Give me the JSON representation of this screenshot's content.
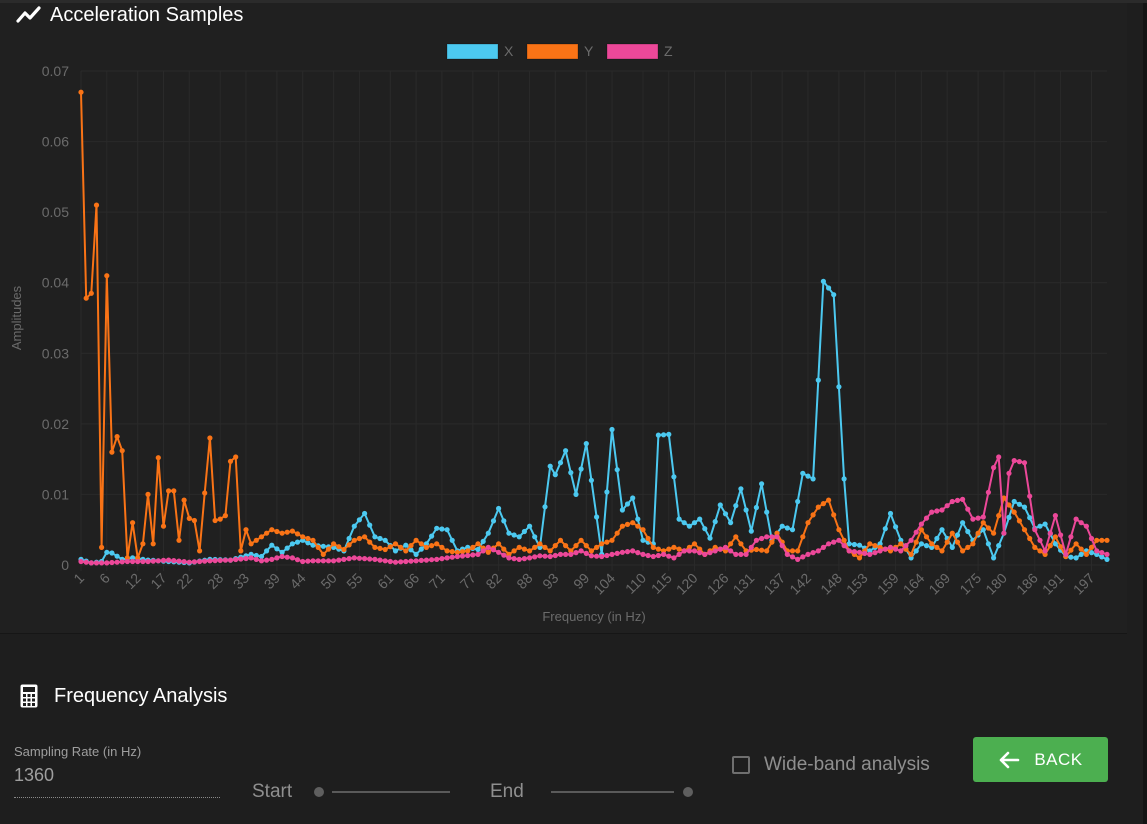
{
  "card": {
    "title": "Acceleration Samples",
    "icon": "line-chart-icon"
  },
  "chart_data": {
    "type": "line",
    "title": "Acceleration Samples",
    "xlabel": "Frequency (in Hz)",
    "ylabel": "Amplitudes",
    "ylim": [
      0,
      0.07
    ],
    "yticks": [
      "0",
      "0.01",
      "0.02",
      "0.03",
      "0.04",
      "0.05",
      "0.06",
      "0.07"
    ],
    "xlim": [
      1,
      200
    ],
    "xtick_labels": [
      "1",
      "6",
      "12",
      "17",
      "22",
      "28",
      "33",
      "39",
      "44",
      "50",
      "55",
      "61",
      "66",
      "71",
      "77",
      "82",
      "88",
      "93",
      "99",
      "104",
      "110",
      "115",
      "120",
      "126",
      "131",
      "137",
      "142",
      "148",
      "153",
      "159",
      "164",
      "169",
      "175",
      "180",
      "186",
      "191",
      "197"
    ],
    "grid": true,
    "legend": "top-center",
    "values_estimated": true,
    "values_note": "Key points are approximate readings traced from the rendered plot (about 200 dense samples per series). Intermediate samples are interpolated, not read.",
    "series": [
      {
        "name": "X",
        "color": "#4cc9f0",
        "key_points": [
          [
            1,
            0.0008
          ],
          [
            3,
            0.0003
          ],
          [
            5,
            0.0005
          ],
          [
            6,
            0.0018
          ],
          [
            7,
            0.0017
          ],
          [
            9,
            0.0008
          ],
          [
            11,
            0.001
          ],
          [
            14,
            0.0007
          ],
          [
            18,
            0.0005
          ],
          [
            22,
            0.0003
          ],
          [
            26,
            0.0008
          ],
          [
            30,
            0.0007
          ],
          [
            34,
            0.0015
          ],
          [
            36,
            0.0012
          ],
          [
            38,
            0.0028
          ],
          [
            40,
            0.0018
          ],
          [
            42,
            0.003
          ],
          [
            44,
            0.0035
          ],
          [
            46,
            0.0028
          ],
          [
            50,
            0.0025
          ],
          [
            52,
            0.002
          ],
          [
            54,
            0.0055
          ],
          [
            56,
            0.0073
          ],
          [
            58,
            0.004
          ],
          [
            60,
            0.0035
          ],
          [
            62,
            0.002
          ],
          [
            64,
            0.0028
          ],
          [
            66,
            0.0015
          ],
          [
            68,
            0.003
          ],
          [
            70,
            0.0052
          ],
          [
            72,
            0.005
          ],
          [
            74,
            0.002
          ],
          [
            76,
            0.0025
          ],
          [
            78,
            0.0022
          ],
          [
            80,
            0.0045
          ],
          [
            82,
            0.008
          ],
          [
            84,
            0.0045
          ],
          [
            86,
            0.004
          ],
          [
            88,
            0.0055
          ],
          [
            90,
            0.0025
          ],
          [
            92,
            0.014
          ],
          [
            93,
            0.0128
          ],
          [
            95,
            0.0162
          ],
          [
            97,
            0.01
          ],
          [
            99,
            0.0172
          ],
          [
            101,
            0.0068
          ],
          [
            102,
            0.0015
          ],
          [
            104,
            0.0192
          ],
          [
            106,
            0.0078
          ],
          [
            108,
            0.0095
          ],
          [
            110,
            0.0035
          ],
          [
            112,
            0.003
          ],
          [
            113,
            0.0184
          ],
          [
            115,
            0.0185
          ],
          [
            117,
            0.0065
          ],
          [
            119,
            0.0055
          ],
          [
            121,
            0.0065
          ],
          [
            123,
            0.0038
          ],
          [
            125,
            0.0085
          ],
          [
            127,
            0.006
          ],
          [
            129,
            0.0108
          ],
          [
            131,
            0.0048
          ],
          [
            133,
            0.0115
          ],
          [
            135,
            0.0035
          ],
          [
            137,
            0.0055
          ],
          [
            139,
            0.005
          ],
          [
            141,
            0.013
          ],
          [
            143,
            0.0122
          ],
          [
            145,
            0.0402
          ],
          [
            147,
            0.0383
          ],
          [
            149,
            0.0122
          ],
          [
            150,
            0.003
          ],
          [
            152,
            0.0028
          ],
          [
            154,
            0.002
          ],
          [
            156,
            0.003
          ],
          [
            158,
            0.0073
          ],
          [
            160,
            0.0035
          ],
          [
            162,
            0.001
          ],
          [
            164,
            0.003
          ],
          [
            166,
            0.0025
          ],
          [
            168,
            0.005
          ],
          [
            170,
            0.0025
          ],
          [
            172,
            0.006
          ],
          [
            174,
            0.0035
          ],
          [
            176,
            0.005
          ],
          [
            178,
            0.001
          ],
          [
            180,
            0.0045
          ],
          [
            182,
            0.009
          ],
          [
            184,
            0.0082
          ],
          [
            186,
            0.0052
          ],
          [
            188,
            0.0058
          ],
          [
            190,
            0.003
          ],
          [
            192,
            0.0012
          ],
          [
            194,
            0.001
          ],
          [
            196,
            0.002
          ],
          [
            198,
            0.0015
          ],
          [
            200,
            0.0008
          ]
        ]
      },
      {
        "name": "Y",
        "color": "#f97316",
        "key_points": [
          [
            1,
            0.067
          ],
          [
            2,
            0.0378
          ],
          [
            3,
            0.0385
          ],
          [
            4,
            0.051
          ],
          [
            5,
            0.0025
          ],
          [
            6,
            0.041
          ],
          [
            7,
            0.016
          ],
          [
            8,
            0.0182
          ],
          [
            9,
            0.0162
          ],
          [
            10,
            0.001
          ],
          [
            11,
            0.006
          ],
          [
            12,
            0.001
          ],
          [
            13,
            0.003
          ],
          [
            14,
            0.01
          ],
          [
            15,
            0.003
          ],
          [
            16,
            0.0152
          ],
          [
            17,
            0.0055
          ],
          [
            18,
            0.0105
          ],
          [
            19,
            0.0105
          ],
          [
            20,
            0.0035
          ],
          [
            21,
            0.0092
          ],
          [
            22,
            0.0066
          ],
          [
            23,
            0.0063
          ],
          [
            24,
            0.002
          ],
          [
            25,
            0.0102
          ],
          [
            26,
            0.018
          ],
          [
            27,
            0.0063
          ],
          [
            28,
            0.0065
          ],
          [
            29,
            0.007
          ],
          [
            30,
            0.0147
          ],
          [
            31,
            0.0153
          ],
          [
            32,
            0.002
          ],
          [
            33,
            0.005
          ],
          [
            34,
            0.003
          ],
          [
            36,
            0.004
          ],
          [
            38,
            0.005
          ],
          [
            40,
            0.0045
          ],
          [
            42,
            0.0048
          ],
          [
            44,
            0.004
          ],
          [
            46,
            0.0035
          ],
          [
            48,
            0.0015
          ],
          [
            50,
            0.003
          ],
          [
            52,
            0.0022
          ],
          [
            54,
            0.0035
          ],
          [
            56,
            0.004
          ],
          [
            58,
            0.0025
          ],
          [
            60,
            0.0022
          ],
          [
            62,
            0.003
          ],
          [
            64,
            0.002
          ],
          [
            66,
            0.0035
          ],
          [
            68,
            0.0025
          ],
          [
            70,
            0.003
          ],
          [
            72,
            0.002
          ],
          [
            74,
            0.0018
          ],
          [
            76,
            0.002
          ],
          [
            78,
            0.003
          ],
          [
            80,
            0.0018
          ],
          [
            82,
            0.003
          ],
          [
            84,
            0.0015
          ],
          [
            86,
            0.0025
          ],
          [
            88,
            0.002
          ],
          [
            90,
            0.003
          ],
          [
            92,
            0.002
          ],
          [
            94,
            0.0035
          ],
          [
            96,
            0.002
          ],
          [
            98,
            0.0035
          ],
          [
            100,
            0.002
          ],
          [
            102,
            0.003
          ],
          [
            104,
            0.0035
          ],
          [
            106,
            0.0055
          ],
          [
            108,
            0.006
          ],
          [
            110,
            0.005
          ],
          [
            112,
            0.0025
          ],
          [
            114,
            0.002
          ],
          [
            116,
            0.0025
          ],
          [
            118,
            0.002
          ],
          [
            120,
            0.003
          ],
          [
            122,
            0.0015
          ],
          [
            124,
            0.0025
          ],
          [
            126,
            0.002
          ],
          [
            128,
            0.004
          ],
          [
            130,
            0.002
          ],
          [
            132,
            0.0022
          ],
          [
            134,
            0.002
          ],
          [
            136,
            0.0045
          ],
          [
            138,
            0.002
          ],
          [
            140,
            0.002
          ],
          [
            142,
            0.006
          ],
          [
            144,
            0.0082
          ],
          [
            146,
            0.0092
          ],
          [
            148,
            0.005
          ],
          [
            150,
            0.002
          ],
          [
            152,
            0.001
          ],
          [
            154,
            0.003
          ],
          [
            156,
            0.0025
          ],
          [
            158,
            0.002
          ],
          [
            160,
            0.003
          ],
          [
            162,
            0.0015
          ],
          [
            164,
            0.005
          ],
          [
            166,
            0.003
          ],
          [
            168,
            0.002
          ],
          [
            170,
            0.0045
          ],
          [
            172,
            0.002
          ],
          [
            174,
            0.003
          ],
          [
            176,
            0.006
          ],
          [
            178,
            0.0045
          ],
          [
            180,
            0.0095
          ],
          [
            182,
            0.0075
          ],
          [
            184,
            0.005
          ],
          [
            186,
            0.0025
          ],
          [
            188,
            0.0015
          ],
          [
            190,
            0.004
          ],
          [
            192,
            0.0012
          ],
          [
            194,
            0.003
          ],
          [
            196,
            0.0015
          ],
          [
            198,
            0.0035
          ],
          [
            200,
            0.0035
          ]
        ]
      },
      {
        "name": "Z",
        "color": "#ec4899",
        "key_points": [
          [
            1,
            0.0005
          ],
          [
            3,
            0.0003
          ],
          [
            6,
            0.0003
          ],
          [
            10,
            0.0005
          ],
          [
            14,
            0.0005
          ],
          [
            18,
            0.0007
          ],
          [
            22,
            0.0004
          ],
          [
            26,
            0.0006
          ],
          [
            30,
            0.0007
          ],
          [
            34,
            0.001
          ],
          [
            36,
            0.0006
          ],
          [
            38,
            0.0008
          ],
          [
            40,
            0.0012
          ],
          [
            42,
            0.001
          ],
          [
            44,
            0.0005
          ],
          [
            46,
            0.0006
          ],
          [
            50,
            0.0006
          ],
          [
            54,
            0.001
          ],
          [
            58,
            0.0008
          ],
          [
            62,
            0.0004
          ],
          [
            66,
            0.0006
          ],
          [
            70,
            0.0008
          ],
          [
            74,
            0.0012
          ],
          [
            78,
            0.0015
          ],
          [
            80,
            0.0025
          ],
          [
            82,
            0.0018
          ],
          [
            84,
            0.001
          ],
          [
            86,
            0.0008
          ],
          [
            88,
            0.001
          ],
          [
            90,
            0.0013
          ],
          [
            92,
            0.0012
          ],
          [
            94,
            0.0015
          ],
          [
            96,
            0.0015
          ],
          [
            98,
            0.002
          ],
          [
            100,
            0.0013
          ],
          [
            102,
            0.0012
          ],
          [
            104,
            0.0015
          ],
          [
            106,
            0.0018
          ],
          [
            108,
            0.002
          ],
          [
            110,
            0.0015
          ],
          [
            112,
            0.0012
          ],
          [
            114,
            0.0015
          ],
          [
            116,
            0.001
          ],
          [
            118,
            0.002
          ],
          [
            120,
            0.002
          ],
          [
            122,
            0.0015
          ],
          [
            124,
            0.002
          ],
          [
            126,
            0.0025
          ],
          [
            128,
            0.0015
          ],
          [
            130,
            0.0015
          ],
          [
            132,
            0.0035
          ],
          [
            134,
            0.004
          ],
          [
            136,
            0.004
          ],
          [
            138,
            0.0015
          ],
          [
            140,
            0.0008
          ],
          [
            142,
            0.0015
          ],
          [
            144,
            0.002
          ],
          [
            146,
            0.003
          ],
          [
            148,
            0.0035
          ],
          [
            150,
            0.002
          ],
          [
            152,
            0.0018
          ],
          [
            154,
            0.0015
          ],
          [
            156,
            0.002
          ],
          [
            158,
            0.0025
          ],
          [
            160,
            0.002
          ],
          [
            162,
            0.0035
          ],
          [
            164,
            0.0058
          ],
          [
            166,
            0.0075
          ],
          [
            168,
            0.0078
          ],
          [
            170,
            0.009
          ],
          [
            172,
            0.0093
          ],
          [
            174,
            0.0065
          ],
          [
            176,
            0.0068
          ],
          [
            178,
            0.0138
          ],
          [
            179,
            0.0153
          ],
          [
            180,
            0.0045
          ],
          [
            181,
            0.013
          ],
          [
            182,
            0.0148
          ],
          [
            184,
            0.0145
          ],
          [
            186,
            0.005
          ],
          [
            188,
            0.002
          ],
          [
            190,
            0.007
          ],
          [
            192,
            0.0015
          ],
          [
            194,
            0.0065
          ],
          [
            196,
            0.0055
          ],
          [
            198,
            0.002
          ],
          [
            200,
            0.0015
          ]
        ]
      }
    ]
  },
  "analysis": {
    "title": "Frequency Analysis",
    "icon": "calculator-icon",
    "sampling_rate_label": "Sampling Rate (in Hz)",
    "sampling_rate_value": "1360",
    "start_label": "Start",
    "end_label": "End",
    "start_value": 0,
    "end_value": 1,
    "wideband_label": "Wide-band analysis",
    "wideband_checked": false,
    "back_label": "BACK"
  }
}
